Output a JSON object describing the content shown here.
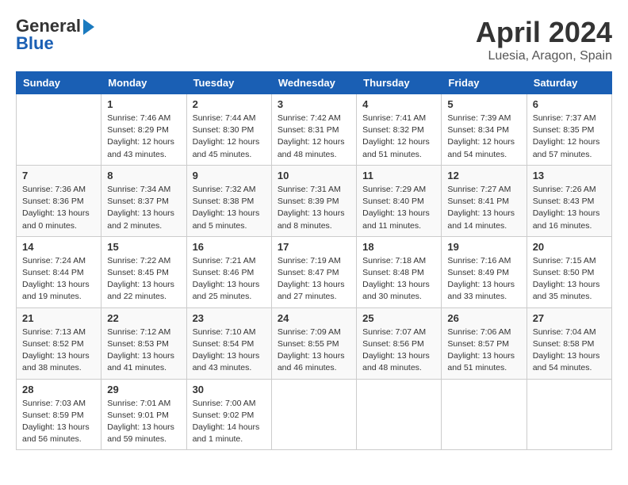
{
  "header": {
    "logo_general": "General",
    "logo_blue": "Blue",
    "month_title": "April 2024",
    "location": "Luesia, Aragon, Spain"
  },
  "weekdays": [
    "Sunday",
    "Monday",
    "Tuesday",
    "Wednesday",
    "Thursday",
    "Friday",
    "Saturday"
  ],
  "weeks": [
    [
      {
        "day": "",
        "info": ""
      },
      {
        "day": "1",
        "info": "Sunrise: 7:46 AM\nSunset: 8:29 PM\nDaylight: 12 hours\nand 43 minutes."
      },
      {
        "day": "2",
        "info": "Sunrise: 7:44 AM\nSunset: 8:30 PM\nDaylight: 12 hours\nand 45 minutes."
      },
      {
        "day": "3",
        "info": "Sunrise: 7:42 AM\nSunset: 8:31 PM\nDaylight: 12 hours\nand 48 minutes."
      },
      {
        "day": "4",
        "info": "Sunrise: 7:41 AM\nSunset: 8:32 PM\nDaylight: 12 hours\nand 51 minutes."
      },
      {
        "day": "5",
        "info": "Sunrise: 7:39 AM\nSunset: 8:34 PM\nDaylight: 12 hours\nand 54 minutes."
      },
      {
        "day": "6",
        "info": "Sunrise: 7:37 AM\nSunset: 8:35 PM\nDaylight: 12 hours\nand 57 minutes."
      }
    ],
    [
      {
        "day": "7",
        "info": "Sunrise: 7:36 AM\nSunset: 8:36 PM\nDaylight: 13 hours\nand 0 minutes."
      },
      {
        "day": "8",
        "info": "Sunrise: 7:34 AM\nSunset: 8:37 PM\nDaylight: 13 hours\nand 2 minutes."
      },
      {
        "day": "9",
        "info": "Sunrise: 7:32 AM\nSunset: 8:38 PM\nDaylight: 13 hours\nand 5 minutes."
      },
      {
        "day": "10",
        "info": "Sunrise: 7:31 AM\nSunset: 8:39 PM\nDaylight: 13 hours\nand 8 minutes."
      },
      {
        "day": "11",
        "info": "Sunrise: 7:29 AM\nSunset: 8:40 PM\nDaylight: 13 hours\nand 11 minutes."
      },
      {
        "day": "12",
        "info": "Sunrise: 7:27 AM\nSunset: 8:41 PM\nDaylight: 13 hours\nand 14 minutes."
      },
      {
        "day": "13",
        "info": "Sunrise: 7:26 AM\nSunset: 8:43 PM\nDaylight: 13 hours\nand 16 minutes."
      }
    ],
    [
      {
        "day": "14",
        "info": "Sunrise: 7:24 AM\nSunset: 8:44 PM\nDaylight: 13 hours\nand 19 minutes."
      },
      {
        "day": "15",
        "info": "Sunrise: 7:22 AM\nSunset: 8:45 PM\nDaylight: 13 hours\nand 22 minutes."
      },
      {
        "day": "16",
        "info": "Sunrise: 7:21 AM\nSunset: 8:46 PM\nDaylight: 13 hours\nand 25 minutes."
      },
      {
        "day": "17",
        "info": "Sunrise: 7:19 AM\nSunset: 8:47 PM\nDaylight: 13 hours\nand 27 minutes."
      },
      {
        "day": "18",
        "info": "Sunrise: 7:18 AM\nSunset: 8:48 PM\nDaylight: 13 hours\nand 30 minutes."
      },
      {
        "day": "19",
        "info": "Sunrise: 7:16 AM\nSunset: 8:49 PM\nDaylight: 13 hours\nand 33 minutes."
      },
      {
        "day": "20",
        "info": "Sunrise: 7:15 AM\nSunset: 8:50 PM\nDaylight: 13 hours\nand 35 minutes."
      }
    ],
    [
      {
        "day": "21",
        "info": "Sunrise: 7:13 AM\nSunset: 8:52 PM\nDaylight: 13 hours\nand 38 minutes."
      },
      {
        "day": "22",
        "info": "Sunrise: 7:12 AM\nSunset: 8:53 PM\nDaylight: 13 hours\nand 41 minutes."
      },
      {
        "day": "23",
        "info": "Sunrise: 7:10 AM\nSunset: 8:54 PM\nDaylight: 13 hours\nand 43 minutes."
      },
      {
        "day": "24",
        "info": "Sunrise: 7:09 AM\nSunset: 8:55 PM\nDaylight: 13 hours\nand 46 minutes."
      },
      {
        "day": "25",
        "info": "Sunrise: 7:07 AM\nSunset: 8:56 PM\nDaylight: 13 hours\nand 48 minutes."
      },
      {
        "day": "26",
        "info": "Sunrise: 7:06 AM\nSunset: 8:57 PM\nDaylight: 13 hours\nand 51 minutes."
      },
      {
        "day": "27",
        "info": "Sunrise: 7:04 AM\nSunset: 8:58 PM\nDaylight: 13 hours\nand 54 minutes."
      }
    ],
    [
      {
        "day": "28",
        "info": "Sunrise: 7:03 AM\nSunset: 8:59 PM\nDaylight: 13 hours\nand 56 minutes."
      },
      {
        "day": "29",
        "info": "Sunrise: 7:01 AM\nSunset: 9:01 PM\nDaylight: 13 hours\nand 59 minutes."
      },
      {
        "day": "30",
        "info": "Sunrise: 7:00 AM\nSunset: 9:02 PM\nDaylight: 14 hours\nand 1 minute."
      },
      {
        "day": "",
        "info": ""
      },
      {
        "day": "",
        "info": ""
      },
      {
        "day": "",
        "info": ""
      },
      {
        "day": "",
        "info": ""
      }
    ]
  ]
}
